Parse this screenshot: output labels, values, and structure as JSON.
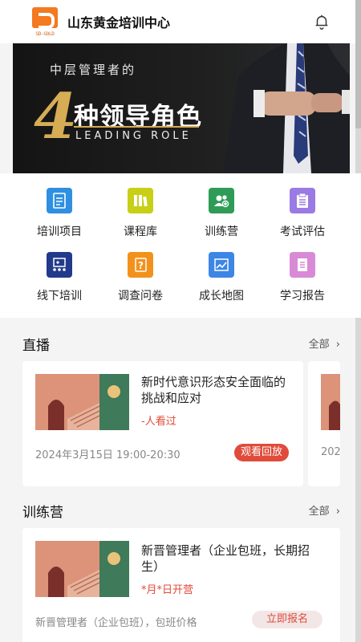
{
  "header": {
    "logo_text": "SD-GOLD",
    "title": "山东黄金培训中心",
    "notification_icon": "bell-icon"
  },
  "banner": {
    "subtitle": "中层管理者的",
    "big_number": "4",
    "main": "种领导角色",
    "english": "LEADING ROLE"
  },
  "grid": {
    "items": [
      {
        "label": "培训项目",
        "icon": "document-icon",
        "color": "#2f8fe0"
      },
      {
        "label": "课程库",
        "icon": "books-icon",
        "color": "#c7cf16"
      },
      {
        "label": "训练营",
        "icon": "group-add-icon",
        "color": "#2e9c57"
      },
      {
        "label": "考试评估",
        "icon": "clipboard-icon",
        "color": "#9b7ae3"
      },
      {
        "label": "线下培训",
        "icon": "classroom-icon",
        "color": "#223a8c"
      },
      {
        "label": "调查问卷",
        "icon": "question-icon",
        "color": "#f2921c"
      },
      {
        "label": "成长地图",
        "icon": "trend-icon",
        "color": "#3d86e6"
      },
      {
        "label": "学习报告",
        "icon": "report-icon",
        "color": "#d88ad6"
      }
    ]
  },
  "live": {
    "title": "直播",
    "all_label": "全部",
    "cards": [
      {
        "title": "新时代意识形态安全面临的挑战和应对",
        "viewers": "-人看过",
        "date": "2024年3月15日 19:00-20:30",
        "action": "观看回放"
      },
      {
        "date_partial": "202"
      }
    ]
  },
  "camp": {
    "title": "训练营",
    "all_label": "全部",
    "cards": [
      {
        "title": "新晋管理者（企业包班，长期招生）",
        "schedule": "*月*日开营",
        "desc": "新晋管理者（企业包班），包班价格",
        "action": "立即报名"
      }
    ]
  },
  "colors": {
    "accent_red": "#e04b3a",
    "gold": "#d6ac55",
    "brand_orange": "#f47920"
  }
}
